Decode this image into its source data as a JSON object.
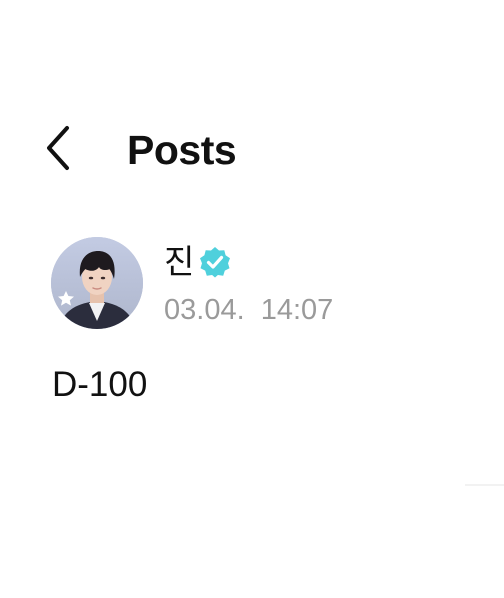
{
  "header": {
    "title": "Posts",
    "back_icon": "chevron-left-icon"
  },
  "post": {
    "author": {
      "name": "진",
      "verified_icon": "verified-badge-icon",
      "verified_color": "#4fd0dc",
      "avatar_icon": "avatar-photo"
    },
    "timestamp": "03.04.  14:07",
    "text": "D-100"
  },
  "colors": {
    "background": "#ffffff",
    "text_primary": "#111111",
    "text_secondary": "#9a9a9a",
    "accent": "#4fd0dc"
  }
}
